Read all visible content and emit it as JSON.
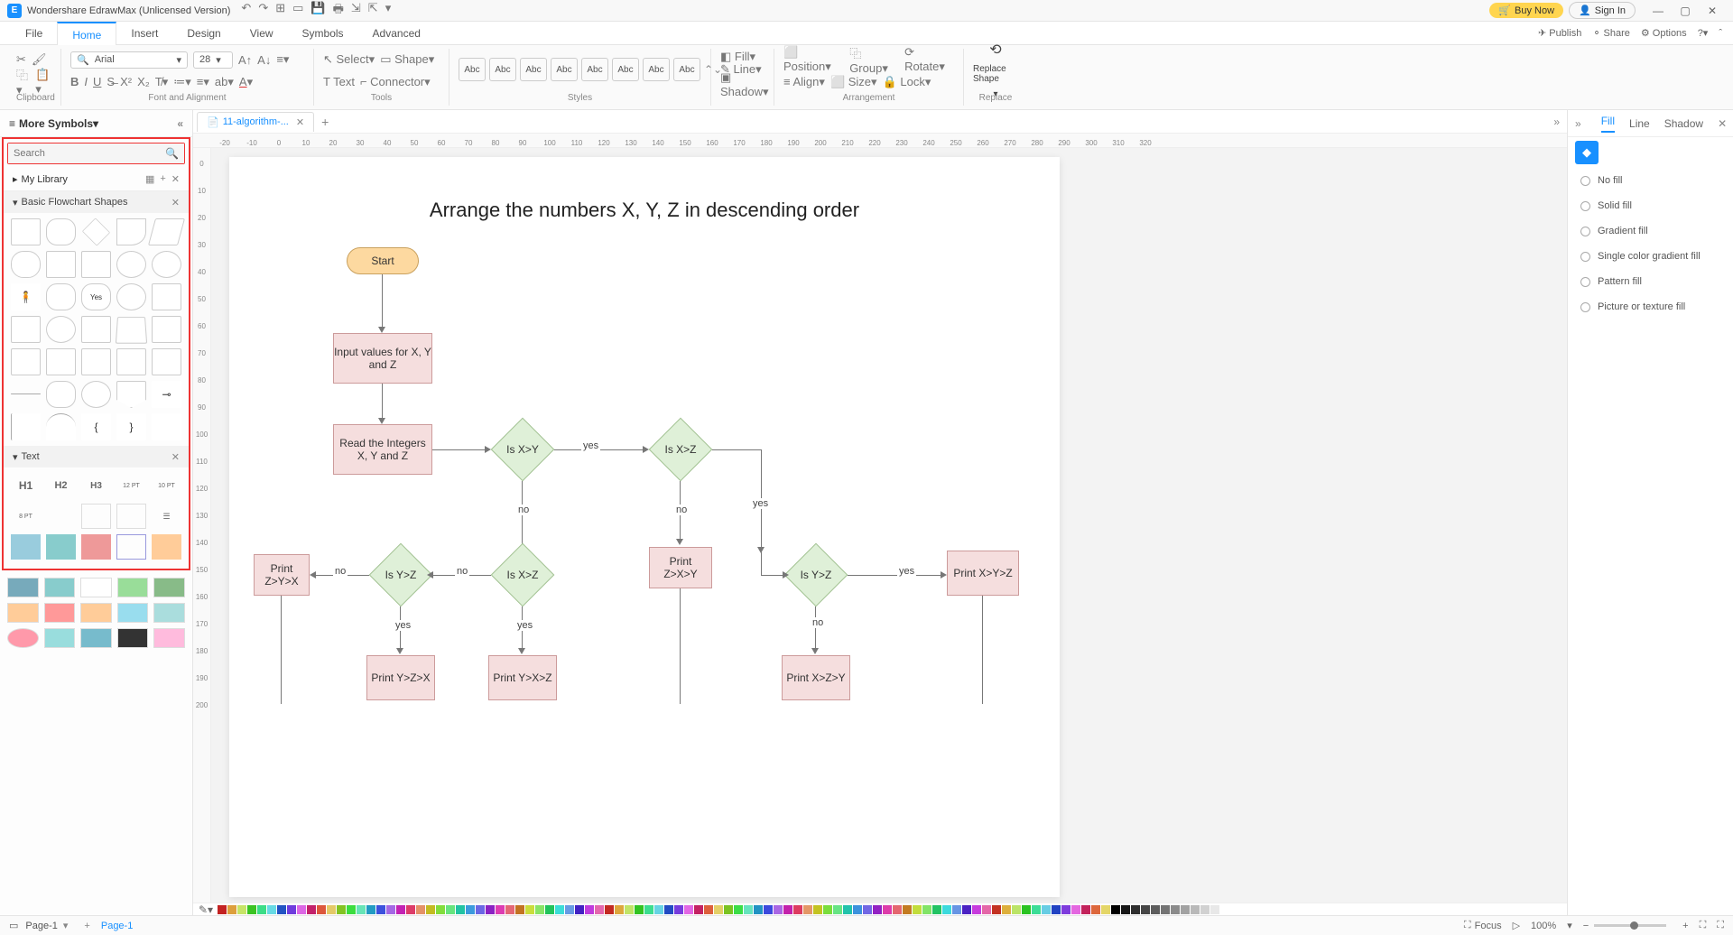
{
  "titlebar": {
    "app_title": "Wondershare EdrawMax (Unlicensed Version)",
    "buy_now": "Buy Now",
    "sign_in": "Sign In"
  },
  "menu": {
    "tabs": [
      "File",
      "Home",
      "Insert",
      "Design",
      "View",
      "Symbols",
      "Advanced"
    ],
    "active": "Home",
    "publish": "Publish",
    "share": "Share",
    "options": "Options"
  },
  "ribbon": {
    "font_name": "Arial",
    "font_size": "28",
    "clipboard_label": "Clipboard",
    "font_label": "Font and Alignment",
    "tools_label": "Tools",
    "styles_label": "Styles",
    "arrangement_label": "Arrangement",
    "replace_label": "Replace",
    "select": "Select",
    "shape": "Shape",
    "text": "Text",
    "connector": "Connector",
    "style_item": "Abc",
    "fill": "Fill",
    "line": "Line",
    "shadow": "Shadow",
    "position": "Position",
    "group": "Group",
    "rotate": "Rotate",
    "align": "Align",
    "size": "Size",
    "lock": "Lock",
    "replace_shape": "Replace Shape"
  },
  "left": {
    "more_symbols": "More Symbols",
    "search_ph": "Search",
    "my_library": "My Library",
    "basic_flowchart": "Basic Flowchart Shapes",
    "text_section": "Text",
    "h1": "H1",
    "h2": "H2",
    "h3": "H3",
    "p12": "12 PT",
    "p10": "10 PT",
    "p8": "8 PT"
  },
  "doc": {
    "tab_name": "11-algorithm-...",
    "ruler_h": [
      "-20",
      "-10",
      "0",
      "10",
      "20",
      "30",
      "40",
      "50",
      "60",
      "70",
      "80",
      "90",
      "100",
      "110",
      "120",
      "130",
      "140",
      "150",
      "160",
      "170",
      "180",
      "190",
      "200",
      "210",
      "220",
      "230",
      "240",
      "250",
      "260",
      "270",
      "280",
      "290",
      "300",
      "310",
      "320"
    ],
    "ruler_v": [
      "0",
      "10",
      "20",
      "30",
      "40",
      "50",
      "60",
      "70",
      "80",
      "90",
      "100",
      "110",
      "120",
      "130",
      "140",
      "150",
      "160",
      "170",
      "180",
      "190",
      "200"
    ]
  },
  "chart_data": {
    "type": "flowchart",
    "title": "Arrange the numbers X, Y, Z in descending order",
    "nodes": {
      "start": {
        "kind": "terminator",
        "label": "Start"
      },
      "input": {
        "kind": "process",
        "label": "Input values for X, Y and Z"
      },
      "read": {
        "kind": "process",
        "label": "Read the Integers X, Y and Z"
      },
      "d1": {
        "kind": "decision",
        "label": "Is X>Y"
      },
      "d2": {
        "kind": "decision",
        "label": "Is X>Z"
      },
      "d3": {
        "kind": "decision",
        "label": "Is Y>Z"
      },
      "d4": {
        "kind": "decision",
        "label": "Is X>Z"
      },
      "d5": {
        "kind": "decision",
        "label": "Is Y>Z"
      },
      "p_zyx": {
        "kind": "process",
        "label": "Print Z>Y>X"
      },
      "p_zxy": {
        "kind": "process",
        "label": "Print Z>X>Y"
      },
      "p_xyz": {
        "kind": "process",
        "label": "Print X>Y>Z"
      },
      "p_yzx": {
        "kind": "process",
        "label": "Print Y>Z>X"
      },
      "p_yxz": {
        "kind": "process",
        "label": "Print Y>X>Z"
      },
      "p_xzy": {
        "kind": "process",
        "label": "Print X>Z>Y"
      }
    },
    "labels": {
      "yes": "yes",
      "no": "no"
    }
  },
  "right": {
    "fill": "Fill",
    "line": "Line",
    "shadow": "Shadow",
    "no_fill": "No fill",
    "solid": "Solid fill",
    "gradient": "Gradient fill",
    "scgrad": "Single color gradient fill",
    "pattern": "Pattern fill",
    "picture": "Picture or texture fill"
  },
  "status": {
    "page": "Page-1",
    "page_tab": "Page-1",
    "focus": "Focus",
    "zoom": "100%"
  }
}
